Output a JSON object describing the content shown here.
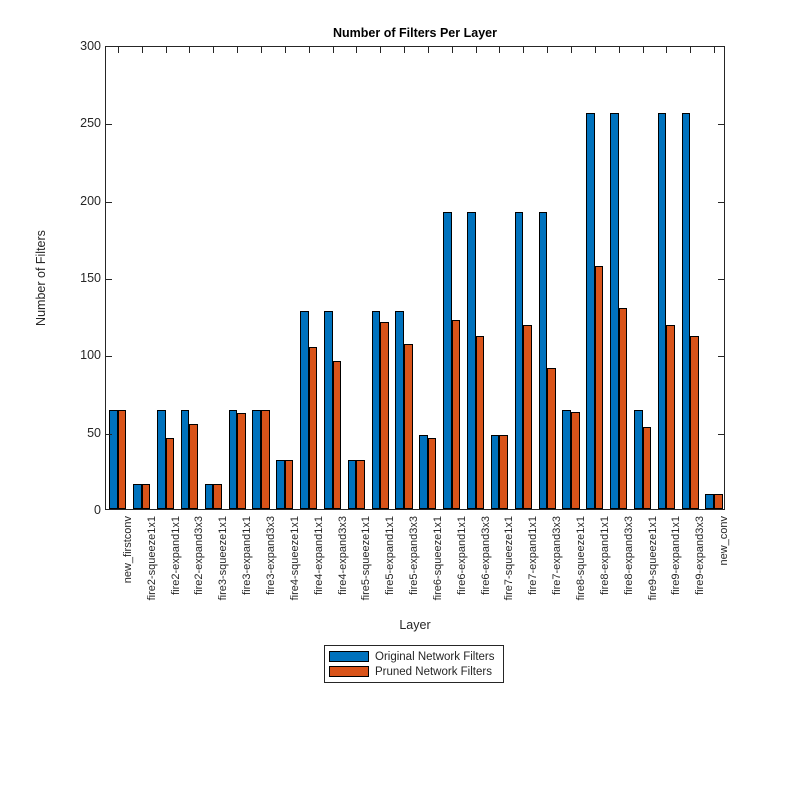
{
  "chart_data": {
    "type": "bar",
    "title": "Number of Filters Per Layer",
    "xlabel": "Layer",
    "ylabel": "Number of Filters",
    "ylim": [
      0,
      300
    ],
    "yticks": [
      0,
      50,
      100,
      150,
      200,
      250,
      300
    ],
    "grid": false,
    "legend_position": "below-axes-center",
    "categories": [
      "new_firstconv",
      "fire2-squeeze1x1",
      "fire2-expand1x1",
      "fire2-expand3x3",
      "fire3-squeeze1x1",
      "fire3-expand1x1",
      "fire3-expand3x3",
      "fire4-squeeze1x1",
      "fire4-expand1x1",
      "fire4-expand3x3",
      "fire5-squeeze1x1",
      "fire5-expand1x1",
      "fire5-expand3x3",
      "fire6-squeeze1x1",
      "fire6-expand1x1",
      "fire6-expand3x3",
      "fire7-squeeze1x1",
      "fire7-expand1x1",
      "fire7-expand3x3",
      "fire8-squeeze1x1",
      "fire8-expand1x1",
      "fire8-expand3x3",
      "fire9-squeeze1x1",
      "fire9-expand1x1",
      "fire9-expand3x3",
      "new_conv"
    ],
    "series": [
      {
        "name": "Original Network Filters",
        "color": "#0072BD",
        "values": [
          64,
          16,
          64,
          64,
          16,
          64,
          64,
          32,
          128,
          128,
          32,
          128,
          128,
          48,
          192,
          192,
          48,
          192,
          192,
          64,
          256,
          256,
          64,
          256,
          256,
          10
        ]
      },
      {
        "name": "Pruned Network Filters",
        "color": "#D95319",
        "values": [
          64,
          16,
          46,
          55,
          16,
          62,
          64,
          32,
          105,
          96,
          32,
          121,
          107,
          46,
          122,
          112,
          48,
          119,
          91,
          63,
          157,
          130,
          53,
          119,
          112,
          10
        ]
      }
    ]
  },
  "legend": {
    "entries": [
      {
        "label": "Original Network Filters",
        "swatch": "orig"
      },
      {
        "label": "Pruned Network Filters",
        "swatch": "pruned"
      }
    ]
  },
  "colors": {
    "original": "#0072BD",
    "pruned": "#D95319",
    "axis": "#262626",
    "background": "#ffffff"
  }
}
